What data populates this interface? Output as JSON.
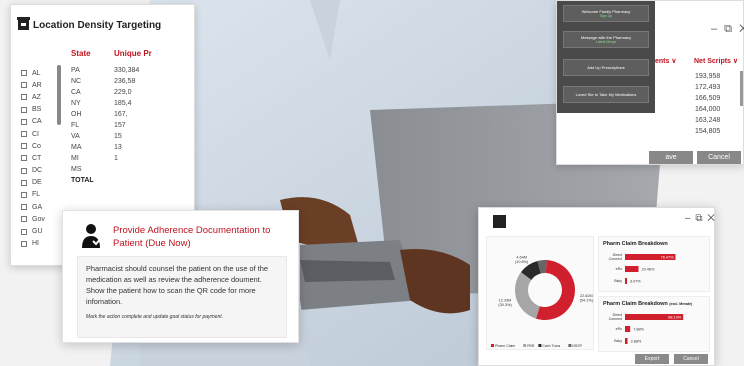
{
  "location_window": {
    "title": "Location Density Targeting",
    "headers": {
      "state": "State",
      "unique": "Unique Pr"
    },
    "checkbox_states": [
      "AL",
      "AR",
      "AZ",
      "BS",
      "CA",
      "CI",
      "Co",
      "CT",
      "DC",
      "DE",
      "FL",
      "GA",
      "Gov",
      "GU",
      "HI"
    ],
    "rows": [
      {
        "state": "PA",
        "value": "330,384"
      },
      {
        "state": "NC",
        "value": "236,58"
      },
      {
        "state": "CA",
        "value": "229,0"
      },
      {
        "state": "NY",
        "value": "185,4"
      },
      {
        "state": "OH",
        "value": "167,"
      },
      {
        "state": "FL",
        "value": "157"
      },
      {
        "state": "VA",
        "value": "15"
      },
      {
        "state": "MA",
        "value": "13"
      },
      {
        "state": "MI",
        "value": "1"
      },
      {
        "state": "MS",
        "value": ""
      },
      {
        "state": "TOTAL",
        "value": ""
      }
    ]
  },
  "scripts_window": {
    "actions": [
      {
        "label": "Welcome Family Pharmacy",
        "sub": "Sign Up"
      },
      {
        "label": "Message with the Pharmacy",
        "sub": "Latest Merge"
      },
      {
        "label": "Add Up Prescriptions",
        "sub": ""
      },
      {
        "label": "Loved Ste to Take My Medications",
        "sub": ""
      }
    ],
    "window_controls": "– ⧉ ✕",
    "col1_header": "ents ∨",
    "col2_header": "Net Scripts ∨",
    "net_scripts": [
      "193,958",
      "172,493",
      "166,509",
      "164,000",
      "163,248",
      "154,805"
    ],
    "save_label": "ave",
    "cancel_label": "Cancel"
  },
  "adherence_card": {
    "title": "Provide Adherence Documentation to Patient (Due Now)",
    "body": "Pharmacist should counsel the patient on the use of the medication as well as review the adherence doument. Show the patient how to scan the QR code for more infomation.",
    "note": "Mark the action complete and update goal status for payment."
  },
  "chart_window": {
    "window_controls": "– ⧉ ✕",
    "export_label": "Export",
    "cancel_label": "Cancel"
  },
  "chart_data": [
    {
      "type": "pie",
      "title": "",
      "categories": [
        "Pharm Claim",
        "PBR",
        "Cash Trans",
        "NSSP"
      ],
      "data_labels": [
        "22.62M\n(54.1%)",
        "4.64M\n(10.8%)",
        "12.33M\n(30.3%)"
      ],
      "slices": [
        {
          "name": "Pharm Claim",
          "value": 54.1,
          "label_value": "22.62M",
          "label_pct": "(54.1%)",
          "color": "#d0202e"
        },
        {
          "name": "PBR",
          "value": 30.3,
          "label_value": "12.33M",
          "label_pct": "(30.3%)",
          "color": "#a6a6a6"
        },
        {
          "name": "Cash Trans",
          "value": 10.8,
          "label_value": "4.64M",
          "label_pct": "(10.8%)",
          "color": "#2a2a2a"
        },
        {
          "name": "NSSP",
          "value": 4.8,
          "label_value": "",
          "label_pct": "",
          "color": "#666666"
        }
      ]
    },
    {
      "type": "bar",
      "title": "Pharm Claim Breakdown",
      "categories": [
        "Direct Connect",
        "eRx",
        "Bsky"
      ],
      "values": [
        76.47,
        20.46,
        3.07
      ],
      "labels": [
        "76.47%",
        "20.46%",
        "3.07%"
      ],
      "color": "#d0202e"
    },
    {
      "type": "bar",
      "title": "Pharm Claim Breakdown",
      "title_suffix": "(excl. Mevate)",
      "categories": [
        "Direct Connect",
        "eRx",
        "Bsky"
      ],
      "values": [
        88.13,
        7.88,
        3.88
      ],
      "labels": [
        "88.13%",
        "7.88%",
        "3.88%"
      ],
      "color": "#d0202e"
    }
  ]
}
